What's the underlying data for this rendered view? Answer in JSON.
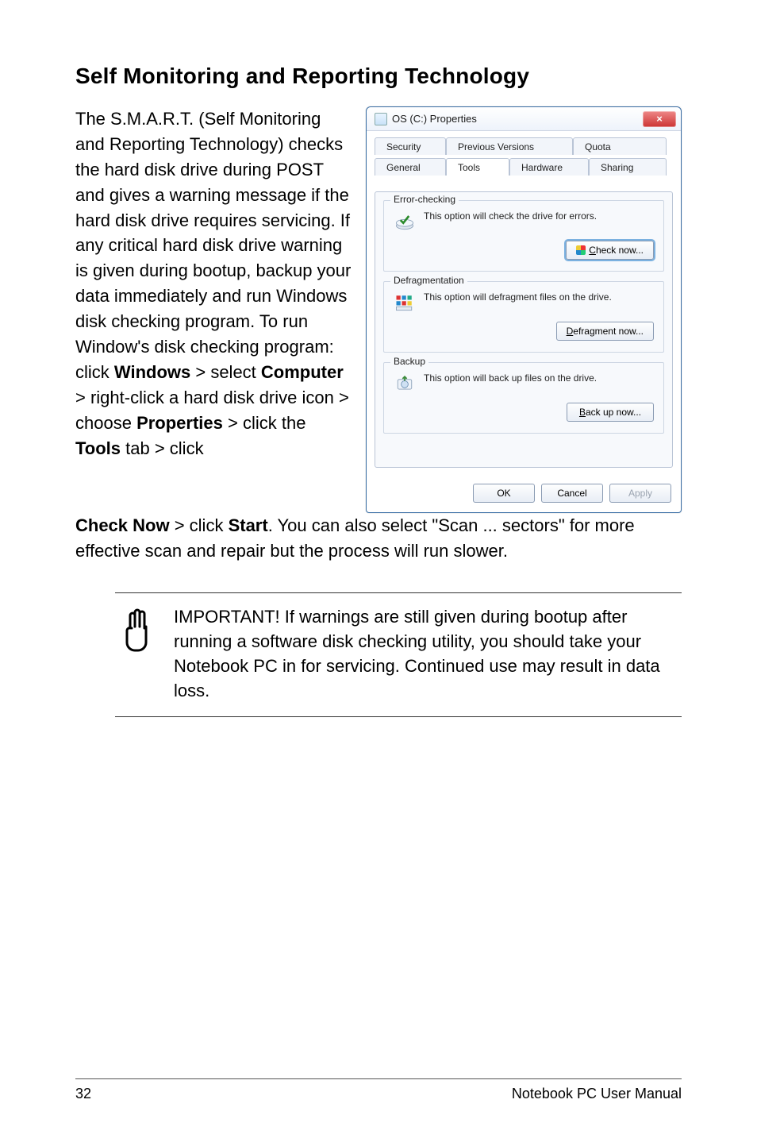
{
  "title": "Self Monitoring and Reporting Technology",
  "body_left": "The S.M.A.R.T. (Self Monitoring and Reporting Technology) checks the hard disk drive during POST and gives a warning message if the hard disk drive requires servicing. If any critical hard disk drive warning is given during bootup, backup your data immediately and run Windows disk checking program. To run Window's disk checking program: click ",
  "seq": {
    "windows": "Windows",
    "gt1": " > select ",
    "computer": "Computer",
    "gt2": " > right-click a hard disk drive icon > choose ",
    "properties": "Properties",
    "gt3": " > click the ",
    "tools": "Tools",
    "gt4": " tab > click ",
    "checknow": "Check Now",
    "gt5": " > click ",
    "start": "Start",
    "tail": ". You can also select \"Scan ... sectors\" for more effective scan and repair but the process will run slower."
  },
  "callout": "IMPORTANT! If warnings are still given during bootup after running a software disk checking utility, you should take your Notebook PC in for servicing. Continued use may result in data loss.",
  "footer": {
    "page": "32",
    "manual": "Notebook PC User Manual"
  },
  "dialog": {
    "title": "OS (C:) Properties",
    "close": "×",
    "tabs_back": {
      "security": "Security",
      "prev": "Previous Versions",
      "quota": "Quota"
    },
    "tabs_front": {
      "general": "General",
      "tools": "Tools",
      "hardware": "Hardware",
      "sharing": "Sharing"
    },
    "error_checking": {
      "legend": "Error-checking",
      "desc": "This option will check the drive for errors.",
      "button_pre": "C",
      "button_rest": "heck now..."
    },
    "defrag": {
      "legend": "Defragmentation",
      "desc": "This option will defragment files on the drive.",
      "button_pre": "D",
      "button_rest": "efragment now..."
    },
    "backup": {
      "legend": "Backup",
      "desc": "This option will back up files on the drive.",
      "button_pre": "B",
      "button_rest": "ack up now..."
    },
    "footer_buttons": {
      "ok": "OK",
      "cancel": "Cancel",
      "apply": "Apply"
    }
  }
}
